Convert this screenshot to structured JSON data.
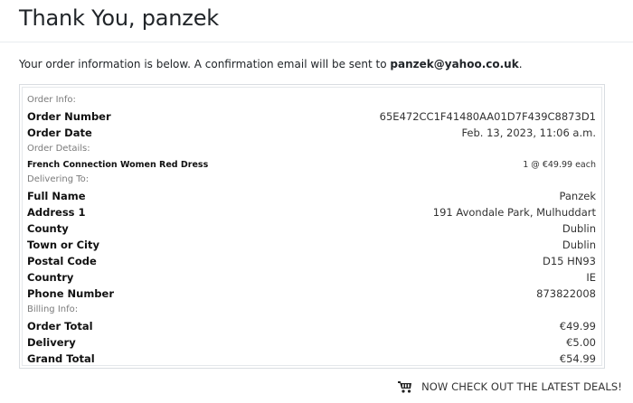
{
  "header": {
    "title": "Thank You, panzek"
  },
  "intro": {
    "text": "Your order information is below. A confirmation email will be sent to ",
    "email": "panzek@yahoo.co.uk",
    "suffix": "."
  },
  "order": {
    "sections": {
      "order_info": "Order Info:",
      "order_details": "Order Details:",
      "delivering_to": "Delivering To:",
      "billing_info": "Billing Info:"
    },
    "order_number": {
      "label": "Order Number",
      "value": "65E472CC1F41480AA01D7F439C8873D1"
    },
    "order_date": {
      "label": "Order Date",
      "value": "Feb. 13, 2023, 11:06 a.m."
    },
    "item": {
      "name": "French Connection Women Red Dress",
      "quantity_price": "1 @ €49.99 each"
    },
    "full_name": {
      "label": "Full Name",
      "value": "Panzek"
    },
    "address1": {
      "label": "Address 1",
      "value": "191 Avondale Park, Mulhuddart"
    },
    "county": {
      "label": "County",
      "value": "Dublin"
    },
    "town": {
      "label": "Town or City",
      "value": "Dublin"
    },
    "postal_code": {
      "label": "Postal Code",
      "value": "D15 HN93"
    },
    "country": {
      "label": "Country",
      "value": "IE"
    },
    "phone": {
      "label": "Phone Number",
      "value": "873822008"
    },
    "order_total": {
      "label": "Order Total",
      "value": "€49.99"
    },
    "delivery": {
      "label": "Delivery",
      "value": "€5.00"
    },
    "grand_total": {
      "label": "Grand Total",
      "value": "€54.99"
    }
  },
  "cta": {
    "label": "NOW CHECK OUT THE LATEST DEALS!",
    "icon": "shopping-carts-icon"
  }
}
